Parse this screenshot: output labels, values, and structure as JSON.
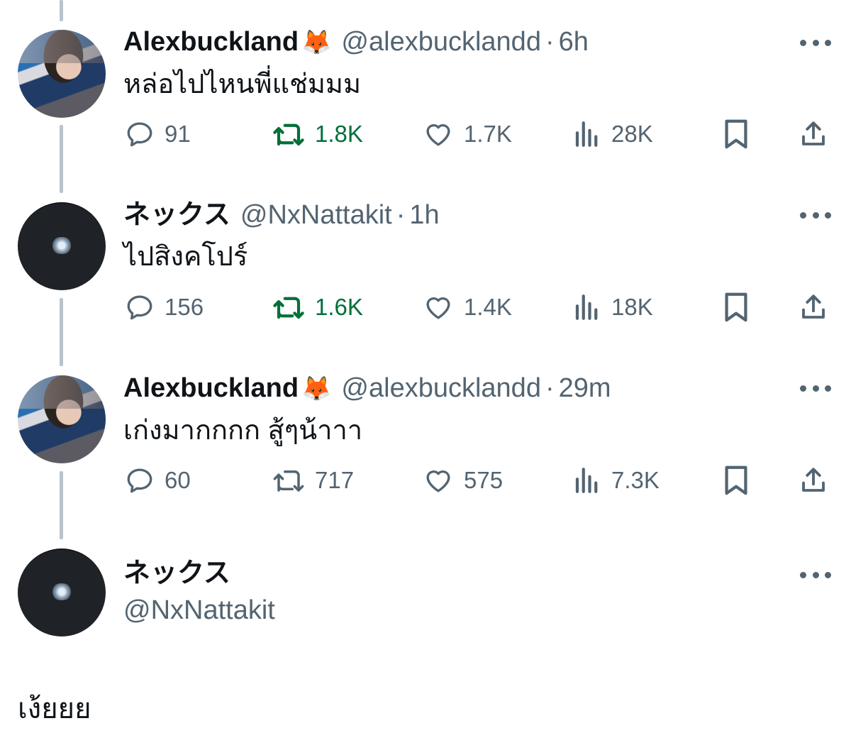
{
  "tweets": [
    {
      "name": "Alexbuckland",
      "emoji": "🦊",
      "handle": "@alexbucklandd",
      "time": "6h",
      "text": "หล่อไปไหนพี่แช่มมม",
      "replies": "91",
      "retweets": "1.8K",
      "likes": "1.7K",
      "views": "28K",
      "retweeted": true
    },
    {
      "name": "ネックス",
      "emoji": "",
      "handle": "@NxNattakit",
      "time": "1h",
      "text": "ไปสิงคโปร์",
      "replies": "156",
      "retweets": "1.6K",
      "likes": "1.4K",
      "views": "18K",
      "retweeted": true
    },
    {
      "name": "Alexbuckland",
      "emoji": "🦊",
      "handle": "@alexbucklandd",
      "time": "29m",
      "text": "เก่งมากกกก สู้ๆน้าาา",
      "replies": "60",
      "retweets": "717",
      "likes": "575",
      "views": "7.3K",
      "retweeted": false
    }
  ],
  "main_tweet": {
    "name": "ネックス",
    "handle": "@NxNattakit",
    "text": "เง้ยยย"
  },
  "colors": {
    "retweet_active": "#00703a",
    "muted": "#536471",
    "thread_line": "#b9c3cc"
  },
  "icons": [
    "reply-icon",
    "retweet-icon",
    "like-icon",
    "views-icon",
    "bookmark-icon",
    "share-icon",
    "more-icon"
  ]
}
